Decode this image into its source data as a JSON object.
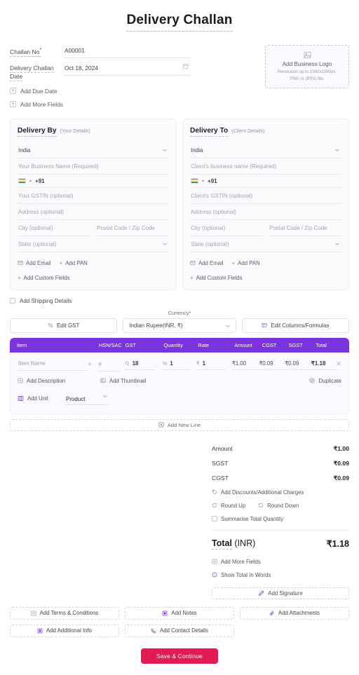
{
  "document": {
    "title": "Delivery Challan"
  },
  "meta": {
    "challan_no_label": "Challan No",
    "challan_no_required_mark": "*",
    "challan_no_value": "A00001",
    "date_label": "Delivery Challan Date",
    "date_value": "Oct 18, 2024",
    "add_due_date": "Add Due Date",
    "add_more_fields": "Add More Fields"
  },
  "logo": {
    "title": "Add Business Logo",
    "line1": "Resolution up to 1080x1080px.",
    "line2": "PNG or JPEG file."
  },
  "delivery_by": {
    "title": "Delivery By",
    "subtitle": "(Your Details)",
    "country": "India",
    "business_name_placeholder": "Your Business Name (Required)",
    "phone_code": "+91",
    "gstin_placeholder": "Your GSTIN (optional)",
    "address_placeholder": "Address (optional)",
    "city_placeholder": "City (optional)",
    "postal_placeholder": "Postal Code / Zip Code",
    "state_placeholder": "State (optional)",
    "add_email": "Add Email",
    "add_pan": "Add PAN",
    "add_custom_fields": "Add Custom Fields"
  },
  "delivery_to": {
    "title": "Delivery To",
    "subtitle": "(Client Details)",
    "country": "India",
    "business_name_placeholder": "Client's business name (Required)",
    "phone_code": "+91",
    "gstin_placeholder": "Client's GSTIN (optional)",
    "address_placeholder": "Address (optional)",
    "city_placeholder": "City (optional)",
    "postal_placeholder": "Postal Code / Zip Code",
    "state_placeholder": "State (optional)",
    "add_email": "Add Email",
    "add_pan": "Add PAN",
    "add_custom_fields": "Add Custom Fields"
  },
  "shipping": {
    "checkbox_label": "Add Shipping Details",
    "checked": false
  },
  "toolbar": {
    "edit_gst_label": "Edit GST",
    "currency_label": "Currency*",
    "currency_value": "Indian Rupee(INR, ₹)",
    "edit_columns_label": "Edit Columns/Formulas"
  },
  "items_table": {
    "columns": [
      "Item",
      "HSN/SAC",
      "GST",
      "Quantity",
      "Rate",
      "Amount",
      "CGST",
      "SGST",
      "Total"
    ],
    "rows": [
      {
        "item_placeholder": "Item Name",
        "hsn_placeholder": "#",
        "gst_value": "18",
        "gst_suffix": "%",
        "quantity": "1",
        "rate": "1",
        "rate_prefix": "₹",
        "amount": "₹1.00",
        "cgst": "₹0.09",
        "sgst": "₹0.09",
        "total": "₹1.18"
      }
    ],
    "row_actions": {
      "add_description": "Add Description",
      "add_thumbnail": "Add Thumbnail",
      "duplicate": "Duplicate",
      "add_unit": "Add Unit",
      "unit_value": "Product"
    },
    "add_new_line": "Add New Line"
  },
  "totals": {
    "lines": [
      {
        "label": "Amount",
        "value": "₹1.00"
      },
      {
        "label": "SGST",
        "value": "₹0.09"
      },
      {
        "label": "CGST",
        "value": "₹0.09"
      }
    ],
    "add_discounts": "Add Discounts/Additional Charges",
    "round_up": "Round Up",
    "round_down": "Round Down",
    "summarise_total_quantity": "Summarise Total Quantity",
    "grand_label_bold": "Total",
    "grand_label_currency": "(INR)",
    "grand_value": "₹1.18",
    "add_more_fields": "Add More Fields",
    "show_total_in_words": "Show Total In Words",
    "add_signature": "Add Signature"
  },
  "bottom_actions": {
    "add_terms": "Add Terms & Conditions",
    "add_notes": "Add Notes",
    "add_attachments": "Add Attachments",
    "add_additional_info": "Add Additional Info",
    "add_contact_details": "Add Contact Details",
    "save_continue": "Save & Continue"
  },
  "colors": {
    "table_header_purple": "#7b33e0",
    "save_button_pink": "#e31b54",
    "accent_violet": "#7b33e0",
    "page_background": "#ffffff"
  }
}
